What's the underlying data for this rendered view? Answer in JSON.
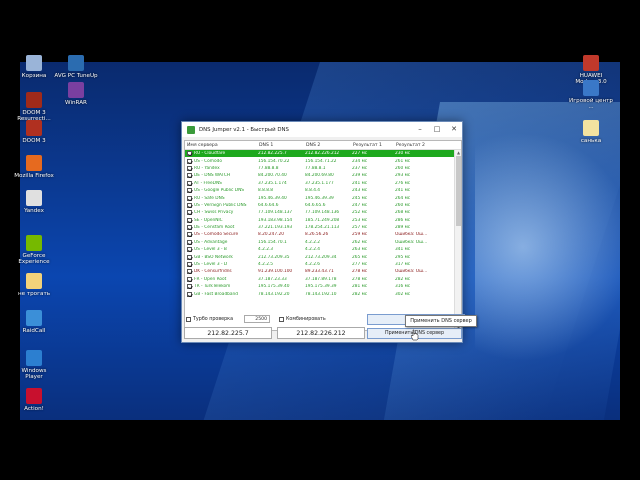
{
  "desktop_icons_left": [
    {
      "label": "Корзина",
      "icon": "recycle-bin-icon",
      "color": "#9ab4d8"
    },
    {
      "label": "AVG PC TuneUp",
      "icon": "tuneup-icon",
      "color": "#2b6cb0"
    },
    {
      "label": "DOOM 3 Resurrecti...",
      "icon": "doom3-icon",
      "color": "#a02a1a"
    },
    {
      "label": "WinRAR",
      "icon": "winrar-icon",
      "color": "#7a3fa0"
    },
    {
      "label": "DOOM 3",
      "icon": "doom3-icon",
      "color": "#b03020"
    },
    {
      "label": "Mozilla Firefox",
      "icon": "firefox-icon",
      "color": "#e66a1f"
    },
    {
      "label": "Yandex",
      "icon": "yandex-browser-icon",
      "color": "#e0e0e0"
    },
    {
      "label": "GeForce Experience",
      "icon": "geforce-icon",
      "color": "#76b900"
    },
    {
      "label": "не трогать",
      "icon": "folder-icon",
      "color": "#f2d27a"
    },
    {
      "label": "RaidCall",
      "icon": "raidcall-icon",
      "color": "#3b8fd8"
    },
    {
      "label": "Windows Player",
      "icon": "media-player-icon",
      "color": "#2c7fd0"
    },
    {
      "label": "Action!",
      "icon": "action-icon",
      "color": "#c8102e"
    }
  ],
  "desktop_icons_right": [
    {
      "label": "HUAWEI Modem 3.0",
      "icon": "huawei-modem-icon",
      "color": "#c0392b"
    },
    {
      "label": "Игровой центр ...",
      "icon": "game-center-icon",
      "color": "#3a78c8"
    },
    {
      "label": "санька",
      "icon": "file-icon",
      "color": "#f3e3a0"
    }
  ],
  "window": {
    "title": "DNS Jumper v2.1 - Быстрый DNS",
    "columns": [
      "Имя сервера",
      "DNS 1",
      "DNS 2",
      "Результат 1",
      "Результат 2"
    ],
    "rows": [
      {
        "name": "RU - Cloudfare",
        "dns1": "212.82.225.7",
        "dns2": "212.82.226.212",
        "r1": "227 мс",
        "r2": "230 мс",
        "color": "#ffffff",
        "selected": true
      },
      {
        "name": "US - Comodo",
        "dns1": "156.154.70.22",
        "dns2": "156.154.71.22",
        "r1": "234 мс",
        "r2": "261 мс",
        "color": "#2a9a2a"
      },
      {
        "name": "RU - Yandex",
        "dns1": "77.88.8.8",
        "dns2": "77.88.8.1",
        "r1": "237 мс",
        "r2": "260 мс",
        "color": "#2a9a2a"
      },
      {
        "name": "DE - DNS WATCH",
        "dns1": "84.200.70.40",
        "dns2": "84.200.69.80",
        "r1": "239 мс",
        "r2": "293 мс",
        "color": "#2a9a2a"
      },
      {
        "name": "AT - FreeDNS",
        "dns1": "37.235.1.174",
        "dns2": "37.235.1.177",
        "r1": "241 мс",
        "r2": "276 мс",
        "color": "#2a9a2a"
      },
      {
        "name": "US - Google Public DNS",
        "dns1": "8.8.8.8",
        "dns2": "8.8.4.4",
        "r1": "243 мс",
        "r2": "241 мс",
        "color": "#2a9a2a"
      },
      {
        "name": "RU - Safe DNS",
        "dns1": "195.46.39.40",
        "dns2": "195.46.39.39",
        "r1": "245 мс",
        "r2": "264 мс",
        "color": "#2a9a2a"
      },
      {
        "name": "US - VeriSign Public DNS",
        "dns1": "64.6.64.6",
        "dns2": "64.6.65.6",
        "r1": "247 мс",
        "r2": "260 мс",
        "color": "#2a9a2a"
      },
      {
        "name": "CH - Swiss Privacy",
        "dns1": "77.109.148.137",
        "dns2": "77.109.148.136",
        "r1": "252 мс",
        "r2": "268 мс",
        "color": "#2a9a2a"
      },
      {
        "name": "SE - OpenNIC",
        "dns1": "193.183.98.154",
        "dns2": "185.71.249.208",
        "r1": "253 мс",
        "r2": "286 мс",
        "color": "#2a9a2a"
      },
      {
        "name": "DE - Censfam Root",
        "dns1": "37.221.193.193",
        "dns2": "178.254.21.113",
        "r1": "257 мс",
        "r2": "289 мс",
        "color": "#2a9a2a"
      },
      {
        "name": "US - Comodo Secure",
        "dns1": "8.20.247.20",
        "dns2": "8.26.56.26",
        "r1": "259 мс",
        "r2": "Ошибка: Ош...",
        "color": "#8a1a1a"
      },
      {
        "name": "US - Advantage",
        "dns1": "156.154.70.1",
        "dns2": "4.2.2.2",
        "r1": "262 мс",
        "r2": "Ошибка: Ош...",
        "color": "#2a9a2a"
      },
      {
        "name": "US - Level 3 - B",
        "dns1": "4.2.2.3",
        "dns2": "4.2.2.4",
        "r1": "263 мс",
        "r2": "341 мс",
        "color": "#2a9a2a"
      },
      {
        "name": "GB - BSO Network",
        "dns1": "212.73.209.35",
        "dns2": "212.73.209.34",
        "r1": "265 мс",
        "r2": "295 мс",
        "color": "#2a9a2a"
      },
      {
        "name": "US - Level 3 - D",
        "dns1": "4.2.2.5",
        "dns2": "4.2.2.6",
        "r1": "277 мс",
        "r2": "317 мс",
        "color": "#2a9a2a"
      },
      {
        "name": "DK - Censurfridns",
        "dns1": "91.239.100.100",
        "dns2": "89.233.43.71",
        "r1": "278 мс",
        "r2": "Ошибка: Ош...",
        "color": "#8a1a1a"
      },
      {
        "name": "FR - Open Root",
        "dns1": "37.187.23.33",
        "dns2": "37.187.89.178",
        "r1": "278 мс",
        "r2": "282 мс",
        "color": "#2a9a2a"
      },
      {
        "name": "TR - TurkTelekom",
        "dns1": "195.175.39.40",
        "dns2": "195.175.39.39",
        "r1": "281 мс",
        "r2": "316 мс",
        "color": "#2a9a2a"
      },
      {
        "name": "GB - Fast Broadband",
        "dns1": "78.143.192.20",
        "dns2": "78.143.192.10",
        "r1": "282 мс",
        "r2": "302 мс",
        "color": "#2a9a2a"
      }
    ],
    "turbo_label": "Турбо проверка",
    "turbo_value": "2500",
    "combine_label": "Комбинировать",
    "dns1_value": "212.82.225.7",
    "dns2_value": "212.82.226.212",
    "start_button": "Запуск",
    "apply_button": "Применить DNS сервер",
    "tooltip": "Применить DNS сервер"
  }
}
